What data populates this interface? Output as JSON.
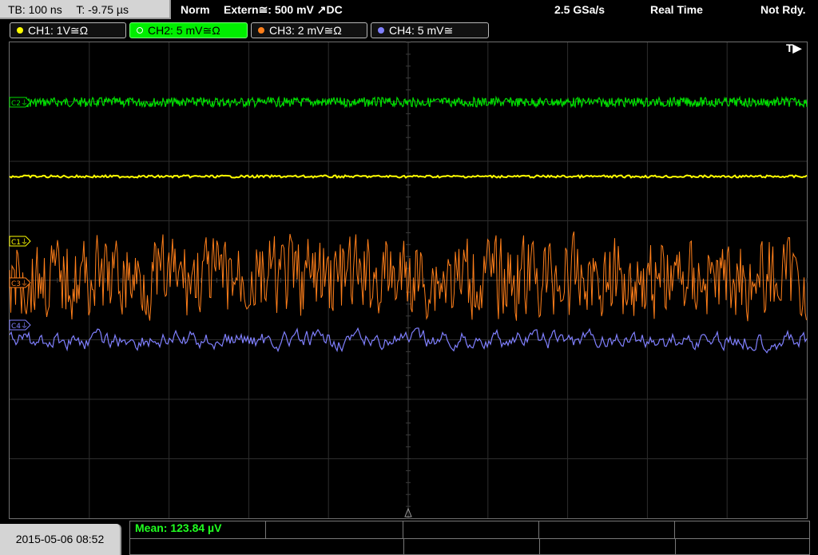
{
  "status": {
    "timebase": "TB: 100 ns",
    "trigger_time": "T: -9.75 µs",
    "mode": "Norm",
    "trigger_source": "Extern≅: 500 mV ↗DC",
    "sample_rate": "2.5 GSa/s",
    "acquisition": "Real Time",
    "ready_state": "Not Rdy."
  },
  "channels": [
    {
      "label": "CH1: 1V≅Ω",
      "color": "#ffff00",
      "marker": "C1"
    },
    {
      "label": "CH2: 5 mV≅Ω",
      "color": "#00dd00",
      "marker": "C2"
    },
    {
      "label": "CH3: 2 mV≅Ω",
      "color": "#ff7f1a",
      "marker": "C3"
    },
    {
      "label": "CH4: 5 mV≅",
      "color": "#8080ff",
      "marker": "C4"
    }
  ],
  "trigger_marker": "T▶",
  "measurement": {
    "text": "Mean: 123.84 µV"
  },
  "datetime": "2015-05-06 08:52"
}
